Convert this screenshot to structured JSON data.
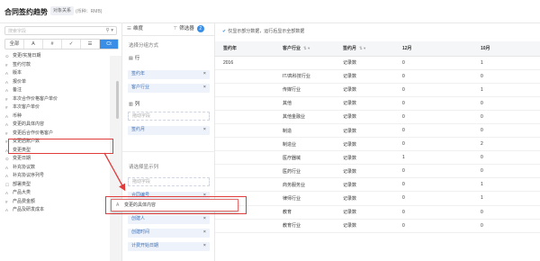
{
  "header": {
    "title": "合同签约趋势",
    "tag": "对象关系",
    "currency": "(币种：RMB)"
  },
  "left": {
    "search_placeholder": "搜索字段",
    "filter_tabs": [
      "全部",
      "A",
      "#",
      "✓",
      "☰",
      "Ct"
    ],
    "fields": [
      {
        "icon": "⊙",
        "label": "变更/实施日期"
      },
      {
        "icon": "#",
        "label": "签约付款"
      },
      {
        "icon": "A",
        "label": "版本"
      },
      {
        "icon": "A",
        "label": "报价单"
      },
      {
        "icon": "A",
        "label": "备注"
      },
      {
        "icon": "#",
        "label": "本次合作价格客户单价"
      },
      {
        "icon": "#",
        "label": "本次客户单价"
      },
      {
        "icon": "A",
        "label": "币种"
      },
      {
        "icon": "A",
        "label": "变更的具体内容"
      },
      {
        "icon": "#",
        "label": "变更后合作价格客户"
      },
      {
        "icon": "#",
        "label": "变更后账户数"
      },
      {
        "icon": "A",
        "label": "变更类型"
      },
      {
        "icon": "⊙",
        "label": "变更日期"
      },
      {
        "icon": "A",
        "label": "补充协议数"
      },
      {
        "icon": "A",
        "label": "补充协议序列号"
      },
      {
        "icon": "☐",
        "label": "部署类型"
      },
      {
        "icon": "A",
        "label": "产品大类"
      },
      {
        "icon": "#",
        "label": "产品费金额"
      },
      {
        "icon": "A",
        "label": "产品及研发成本"
      }
    ]
  },
  "mid": {
    "tabs": [
      {
        "icon": "☰",
        "label": "维度"
      },
      {
        "icon": "⊤",
        "label": "筛选器",
        "badge": "2"
      }
    ],
    "select_method": "选择分组方式",
    "row_label": "行",
    "row_chips": [
      "签约年",
      "客户行业"
    ],
    "col_label": "列",
    "drag_placeholder": "拖动字段",
    "col_chips": [
      "签约月"
    ],
    "display_title": "请选择显示列",
    "display_placeholder": "拖动字段",
    "display_chips": [
      "合同编号",
      "创建人",
      "创建时间",
      "计费开始日期"
    ],
    "ghost_label": "变更的具体内容"
  },
  "right": {
    "notice": "仅显示部分数据，运行后显示全部数据",
    "columns": [
      "签约年",
      "客户行业",
      "签约月",
      "12月",
      "10月"
    ],
    "rows": [
      [
        "2016",
        "",
        "记录数",
        "0",
        "1"
      ],
      [
        "",
        "IT/高科技行业",
        "记录数",
        "0",
        "0"
      ],
      [
        "",
        "传媒行业",
        "记录数",
        "0",
        "1"
      ],
      [
        "",
        "其他",
        "记录数",
        "0",
        "0"
      ],
      [
        "",
        "其他金融业",
        "记录数",
        "0",
        "0"
      ],
      [
        "",
        "制造",
        "记录数",
        "0",
        "0"
      ],
      [
        "",
        "制造业",
        "记录数",
        "0",
        "2"
      ],
      [
        "",
        "医疗器械",
        "记录数",
        "1",
        "0"
      ],
      [
        "",
        "医药行业",
        "记录数",
        "0",
        "0"
      ],
      [
        "",
        "商务服务业",
        "记录数",
        "0",
        "1"
      ],
      [
        "",
        "律师行业",
        "记录数",
        "0",
        "1"
      ],
      [
        "",
        "教育",
        "记录数",
        "0",
        "0"
      ],
      [
        "",
        "教育行业",
        "记录数",
        "0",
        "0"
      ]
    ]
  },
  "colors": {
    "accent": "#3a8ee6",
    "highlight": "#e03c3c"
  }
}
